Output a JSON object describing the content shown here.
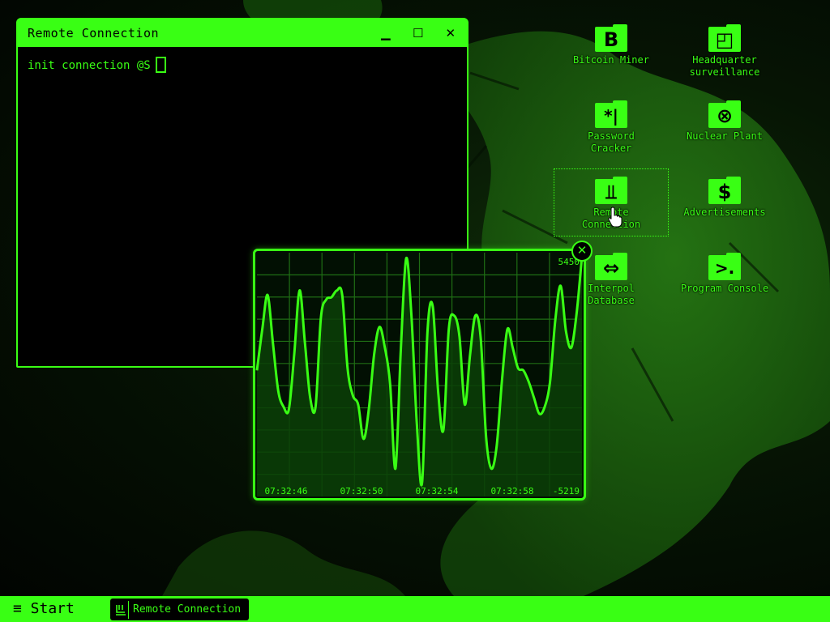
{
  "colors": {
    "accent": "#39ff14",
    "background": "#000000",
    "chart_fill": "#0a3f07"
  },
  "desktop": {
    "icons": [
      {
        "id": "bitcoin",
        "glyph": "B",
        "label": "Bitcoin Miner",
        "icon": "bitcoin-icon"
      },
      {
        "id": "hq",
        "glyph": "◰",
        "label": "Headquarter\nsurveillance",
        "icon": "surveillance-icon"
      },
      {
        "id": "password",
        "glyph": "*|",
        "label": "Password\nCracker",
        "icon": "password-cracker-icon"
      },
      {
        "id": "nuclear",
        "glyph": "⊗",
        "label": "Nuclear Plant",
        "icon": "nuclear-icon"
      },
      {
        "id": "remote",
        "glyph": "⫫",
        "label": "Remote\nConnection",
        "icon": "remote-connection-icon"
      },
      {
        "id": "ads",
        "glyph": "$",
        "label": "Advertisements",
        "icon": "dollar-icon"
      },
      {
        "id": "interpol",
        "glyph": "⇔",
        "label": "Interpol\nDatabase",
        "icon": "database-icon"
      },
      {
        "id": "console",
        "glyph": ">.",
        "label": "Program Console",
        "icon": "console-icon"
      }
    ]
  },
  "terminal": {
    "title": "Remote Connection",
    "minimize": "▁",
    "maximize": "☐",
    "close": "✕",
    "prompt": "init connection @S"
  },
  "widget": {
    "close": "✕"
  },
  "chart_data": {
    "type": "line",
    "title": "",
    "xlabel": "",
    "ylabel": "",
    "ylim": [
      -5219,
      5450
    ],
    "x_tick_labels": [
      "07:32:46",
      "07:32:50",
      "07:32:54",
      "07:32:58"
    ],
    "y_max_label": "5450",
    "y_min_label": "-5219",
    "grid": true,
    "values": [
      300,
      2100,
      3600,
      1500,
      -600,
      -1300,
      -1400,
      1000,
      3800,
      1500,
      -900,
      -1300,
      2600,
      3400,
      3500,
      3800,
      3600,
      400,
      -800,
      -1200,
      -2700,
      -1400,
      1000,
      2200,
      1300,
      -300,
      -4000,
      1200,
      5200,
      2700,
      -2000,
      -4600,
      2000,
      3100,
      -600,
      -2300,
      2100,
      2700,
      1800,
      -1200,
      1000,
      2700,
      1700,
      -2600,
      -4000,
      -3000,
      -100,
      2100,
      1300,
      400,
      300,
      -200,
      -900,
      -1600,
      -1300,
      -200,
      2500,
      4000,
      2000,
      1300,
      2800,
      5300
    ]
  },
  "taskbar": {
    "start_label": "≡ Start",
    "tasks": [
      {
        "label": "Remote Connection",
        "icon": "remote-connection-icon"
      }
    ]
  }
}
